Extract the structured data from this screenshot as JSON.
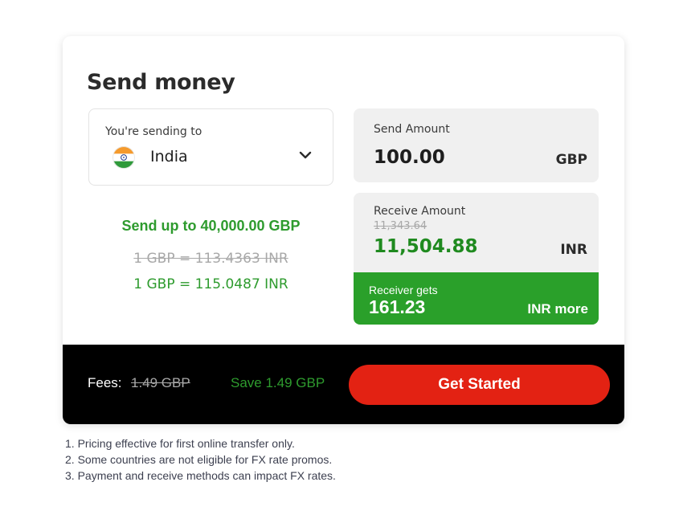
{
  "card": {
    "title": "Send money"
  },
  "destination": {
    "label": "You're sending to",
    "country": "India",
    "flag_icon": "india-flag-icon",
    "dropdown_icon": "chevron-down-icon"
  },
  "promo": {
    "limit_text": "Send up to 40,000.00 GBP",
    "rate_old": "1 GBP = 113.4363 INR",
    "rate_new": "1 GBP = 115.0487 INR"
  },
  "send": {
    "label": "Send Amount",
    "value": "100.00",
    "currency": "GBP"
  },
  "receive": {
    "label": "Receive Amount",
    "old_value": "11,343.64",
    "value": "11,504.88",
    "currency": "INR"
  },
  "receiver_gets": {
    "label": "Receiver gets",
    "value": "161.23",
    "suffix": "INR more"
  },
  "footer": {
    "fees_label": "Fees:",
    "fees_old": "1.49 GBP",
    "save_text": "Save 1.49 GBP",
    "cta_label": "Get Started"
  },
  "notes": [
    "1. Pricing effective for first online transfer only.",
    "2. Some countries are not eligible for FX rate promos.",
    "3. Payment and receive methods can impact FX rates."
  ],
  "colors": {
    "accent_green": "#2e9b2e",
    "receiver_bar": "#2aa02a",
    "cta_red": "#e32213",
    "footer_black": "#000000"
  }
}
